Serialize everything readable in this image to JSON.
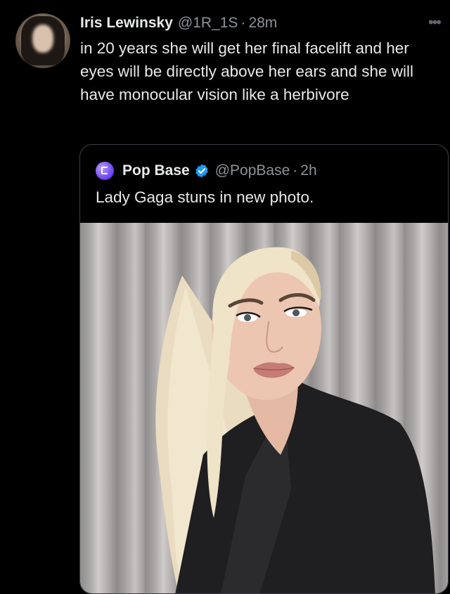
{
  "tweet": {
    "display_name": "Iris Lewinsky",
    "handle": "@1R_1S",
    "separator": "·",
    "time": "28m",
    "more_icon": "more-horizontal-icon",
    "text": "in 20 years she will get her final facelift and her eyes will be directly above her ears and she will have monocular vision like a herbivore"
  },
  "quoted": {
    "display_name": "Pop Base",
    "verified": true,
    "handle": "@PopBase",
    "separator": "·",
    "time": "2h",
    "text": "Lady Gaga stuns in new photo."
  },
  "colors": {
    "background": "#000000",
    "text_primary": "#e7e9ea",
    "text_secondary": "#8b9299",
    "verified_blue": "#1d9bf0",
    "border": "#3b4046"
  }
}
